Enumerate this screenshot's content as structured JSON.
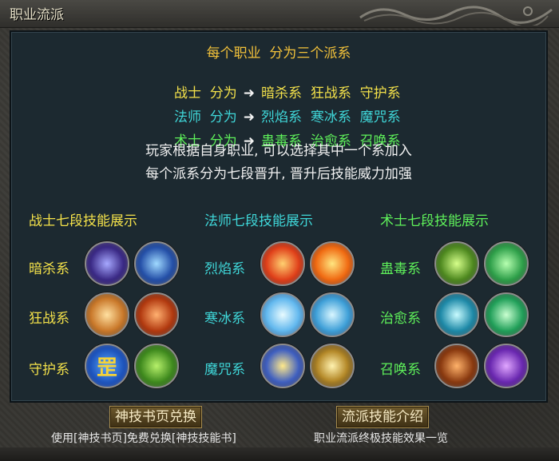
{
  "window": {
    "title": "职业流派"
  },
  "header": {
    "line1": "每个职业  分为三个派系",
    "rows": [
      {
        "cls": "战士",
        "split": "分为",
        "arrow": "➜",
        "sects": [
          "暗杀系",
          "狂战系",
          "守护系"
        ]
      },
      {
        "cls": "法师",
        "split": "分为",
        "arrow": "➜",
        "sects": [
          "烈焰系",
          "寒冰系",
          "魔咒系"
        ]
      },
      {
        "cls": "术士",
        "split": "分为",
        "arrow": "➜",
        "sects": [
          "蛊毒系",
          "治愈系",
          "召唤系"
        ]
      }
    ],
    "desc1": "玩家根据自身职业, 可以选择其中一个系加入",
    "desc2": "每个派系分为七段晋升, 晋升后技能威力加强"
  },
  "sections": [
    {
      "title": "战士七段技能展示",
      "skills": [
        "暗杀系",
        "狂战系",
        "守护系"
      ]
    },
    {
      "title": "法师七段技能展示",
      "skills": [
        "烈焰系",
        "寒冰系",
        "魔咒系"
      ]
    },
    {
      "title": "术士七段技能展示",
      "skills": [
        "蛊毒系",
        "治愈系",
        "召唤系"
      ]
    }
  ],
  "buttons": {
    "skillbook_exchange": "神技书页兑换",
    "skillbook_hint": "使用[神技书页]免费兑换[神技技能书]",
    "sect_intro": "流派技能介绍",
    "sect_hint": "职业流派终极技能效果一览"
  },
  "icon_glyph_guard": "罡",
  "colors": {
    "warrior": "#f2e04a",
    "mage": "#3fd6d8",
    "warlock": "#5ef05a",
    "heading": "#f3c23a"
  }
}
